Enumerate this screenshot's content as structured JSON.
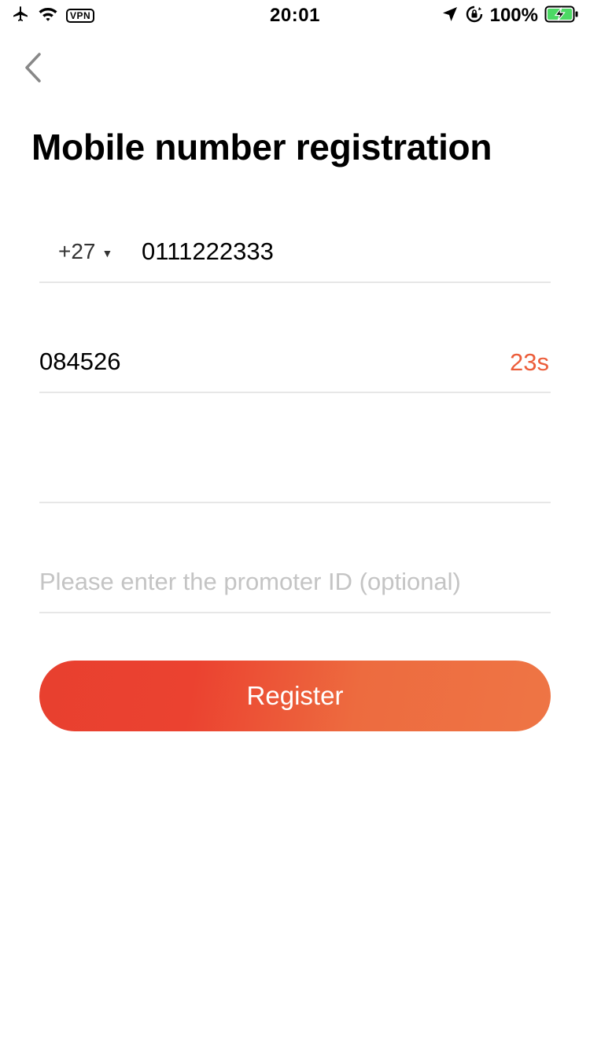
{
  "status_bar": {
    "time": "20:01",
    "vpn_label": "VPN",
    "battery_percent": "100%",
    "icons": [
      "airplane-mode-icon",
      "wifi-icon",
      "vpn-icon",
      "location-icon",
      "orientation-lock-icon",
      "battery-charging-icon"
    ],
    "battery_color": "#4cd964"
  },
  "header": {
    "back_icon": "chevron-left-icon",
    "title": "Mobile number registration"
  },
  "form": {
    "country_code": "+27",
    "country_code_icon": "caret-down-icon",
    "phone_value": "0111222333",
    "verification_code_value": "084526",
    "countdown_text": "23s",
    "password_value": "",
    "promoter_value": "",
    "promoter_placeholder": "Please enter the promoter ID (optional)"
  },
  "actions": {
    "register_label": "Register"
  },
  "colors": {
    "accent": "#ec5d3a",
    "button_gradient_start": "#e8402f",
    "button_gradient_end": "#ee7545",
    "divider": "#e7e7e7",
    "placeholder": "#c4c4c4"
  }
}
